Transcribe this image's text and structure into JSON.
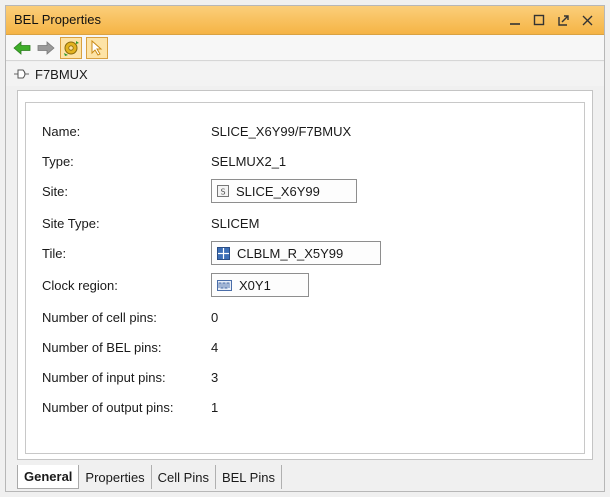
{
  "window": {
    "title": "BEL Properties",
    "controls": {
      "minimize": "_",
      "maximize": "☐",
      "float": "⤢",
      "close": "✕"
    }
  },
  "toolbar": {
    "back_icon": "back-arrow-icon",
    "forward_icon": "forward-arrow-icon",
    "auto_update_icon": "gear-refresh-icon",
    "select_icon": "pointer-icon",
    "accent": "#f5b445"
  },
  "object": {
    "name": "F7BMUX",
    "icon": "bel-icon"
  },
  "properties": {
    "name": {
      "label": "Name:",
      "value": "SLICE_X6Y99/F7BMUX"
    },
    "type": {
      "label": "Type:",
      "value": "SELMUX2_1"
    },
    "site": {
      "label": "Site:",
      "value": "SLICE_X6Y99",
      "icon": "site-icon"
    },
    "site_type": {
      "label": "Site Type:",
      "value": "SLICEM"
    },
    "tile": {
      "label": "Tile:",
      "value": "CLBLM_R_X5Y99",
      "icon": "tile-icon"
    },
    "clock_region": {
      "label": "Clock region:",
      "value": "X0Y1",
      "icon": "clock-region-icon"
    },
    "cell_pins": {
      "label": "Number of cell pins:",
      "value": "0"
    },
    "bel_pins": {
      "label": "Number of BEL pins:",
      "value": "4"
    },
    "input_pins": {
      "label": "Number of input pins:",
      "value": "3"
    },
    "output_pins": {
      "label": "Number of output pins:",
      "value": "1"
    }
  },
  "tabs": [
    {
      "label": "General",
      "active": true
    },
    {
      "label": "Properties",
      "active": false
    },
    {
      "label": "Cell Pins",
      "active": false
    },
    {
      "label": "BEL Pins",
      "active": false
    }
  ]
}
